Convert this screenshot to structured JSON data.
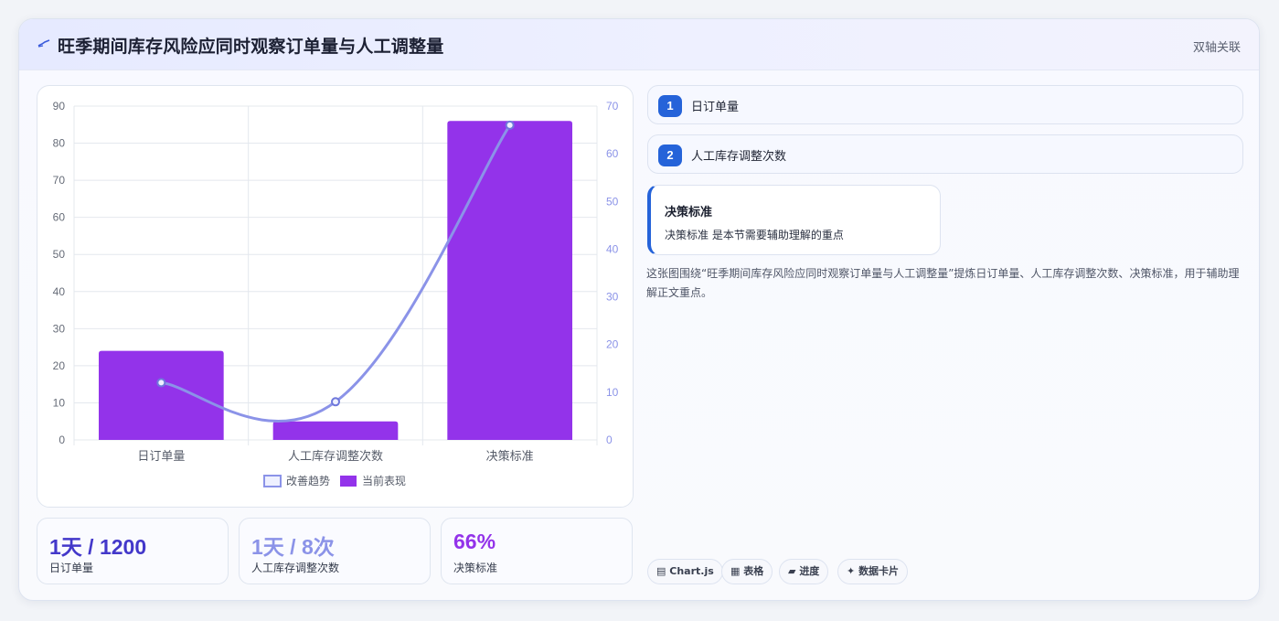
{
  "header": {
    "title": "旺季期间库存风险应同时观察订单量与人工调整量",
    "tag": "双轴关联"
  },
  "chart_data": {
    "type": "bar",
    "categories": [
      "日订单量",
      "人工库存调整次数",
      "决策标准"
    ],
    "series": [
      {
        "name": "当前表现",
        "type": "bar",
        "axis": "left",
        "values": [
          24,
          5,
          86
        ],
        "color": "#9333ea"
      },
      {
        "name": "改善趋势",
        "type": "line",
        "axis": "right",
        "values": [
          12,
          8,
          66
        ],
        "color": "#8b93e8"
      }
    ],
    "ylim": [
      0,
      90
    ],
    "yticks": [
      0,
      10,
      20,
      30,
      40,
      50,
      60,
      70,
      80,
      90
    ],
    "y2lim": [
      0,
      70
    ],
    "y2ticks": [
      0,
      10,
      20,
      30,
      40,
      50,
      60,
      70
    ],
    "legend": [
      "改善趋势",
      "当前表现"
    ],
    "legend_position": "bottom",
    "grid": true
  },
  "stats": [
    {
      "value": "1天 / 1200",
      "label": "日订单量",
      "color": "#4338ca"
    },
    {
      "value": "1天 / 8次",
      "label": "人工库存调整次数",
      "color": "#8b93e8"
    },
    {
      "value": "66%",
      "label": "决策标准",
      "color": "#9333ea"
    }
  ],
  "side": {
    "items": [
      {
        "num": "1",
        "label": "日订单量"
      },
      {
        "num": "2",
        "label": "人工库存调整次数"
      }
    ],
    "decision": {
      "title": "决策标准",
      "text": "决策标准 是本节需要辅助理解的重点"
    },
    "summary": "这张图围绕“旺季期间库存风险应同时观察订单量与人工调整量”提炼日订单量、人工库存调整次数、决策标准，用于辅助理解正文重点。"
  },
  "chips": [
    {
      "icon": "chart-icon",
      "glyph": "▤",
      "label": "Chart.js"
    },
    {
      "icon": "table-icon",
      "glyph": "▦",
      "label": "表格"
    },
    {
      "icon": "progress-icon",
      "glyph": "▰",
      "label": "进度"
    },
    {
      "icon": "card-icon",
      "glyph": "✦",
      "label": "数据卡片"
    }
  ]
}
